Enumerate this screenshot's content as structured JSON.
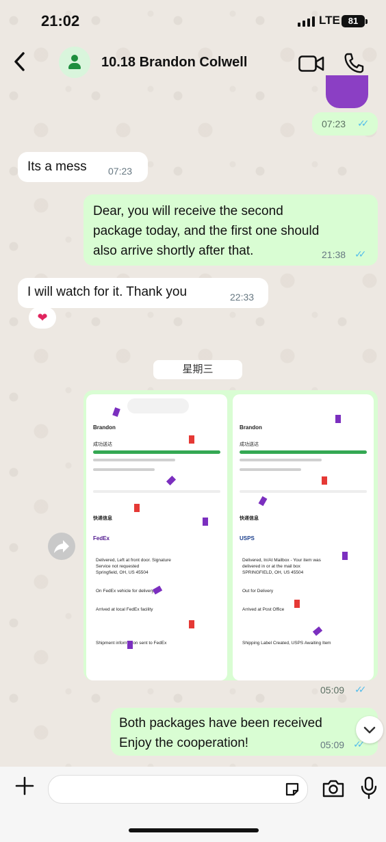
{
  "status": {
    "time": "21:02",
    "network": "LTE",
    "battery": "81"
  },
  "header": {
    "contact_name": "10.18 Brandon Colwell",
    "back_icon": "chevron-left-icon",
    "video_icon": "video-camera-icon",
    "call_icon": "phone-icon"
  },
  "messages": [
    {
      "type": "outgoing-sticker",
      "time": "07:23",
      "read": "✓✓"
    },
    {
      "type": "incoming",
      "text": "Its a mess",
      "time": "07:23"
    },
    {
      "type": "outgoing",
      "lines": [
        "Dear, you will receive the second",
        "package today, and the first one should",
        "also arrive shortly after that."
      ],
      "time": "21:38",
      "read": "✓✓"
    },
    {
      "type": "incoming",
      "text": "I will watch for it. Thank you",
      "time": "22:33",
      "reaction": "❤"
    },
    {
      "type": "date",
      "text": "星期三"
    },
    {
      "type": "outgoing-images",
      "time": "05:09",
      "read": "✓✓"
    },
    {
      "type": "outgoing",
      "lines": [
        "Both packages have been received",
        "Enjoy the cooperation!"
      ],
      "time": "05:09",
      "read": "✓✓"
    }
  ],
  "screenshots": [
    {
      "recipient": "Brandon",
      "status": "成功送达",
      "section": "快递信息",
      "carrier": "FedEx",
      "events": [
        "Delivered, Left at front door. Signature",
        "Service not requested",
        "Springfield, OH, US 45504",
        "On FedEx vehicle for delivery",
        "Arrived at local FedEx facility",
        "Shipment information sent to FedEx"
      ]
    },
    {
      "recipient": "Brandon",
      "status": "成功送达",
      "section": "快递信息",
      "carrier": "USPS",
      "events": [
        "Delivered, In/At Mailbox - Your item was",
        "delivered in or at the mail box",
        "SPRINGFIELD, OH, US 45504",
        "Out for Delivery",
        "Arrived at Post Office",
        "Shipping Label Created, USPS Awaiting Item"
      ]
    }
  ],
  "composer": {
    "plus_icon": "plus-icon",
    "sticker_icon": "sticker-icon",
    "camera_icon": "camera-icon",
    "mic_icon": "microphone-icon"
  },
  "colors": {
    "outgoing_bubble": "#d9fdd3",
    "incoming_bubble": "#ffffff",
    "read_ticks": "#53bdeb",
    "background": "#ede8e2"
  }
}
